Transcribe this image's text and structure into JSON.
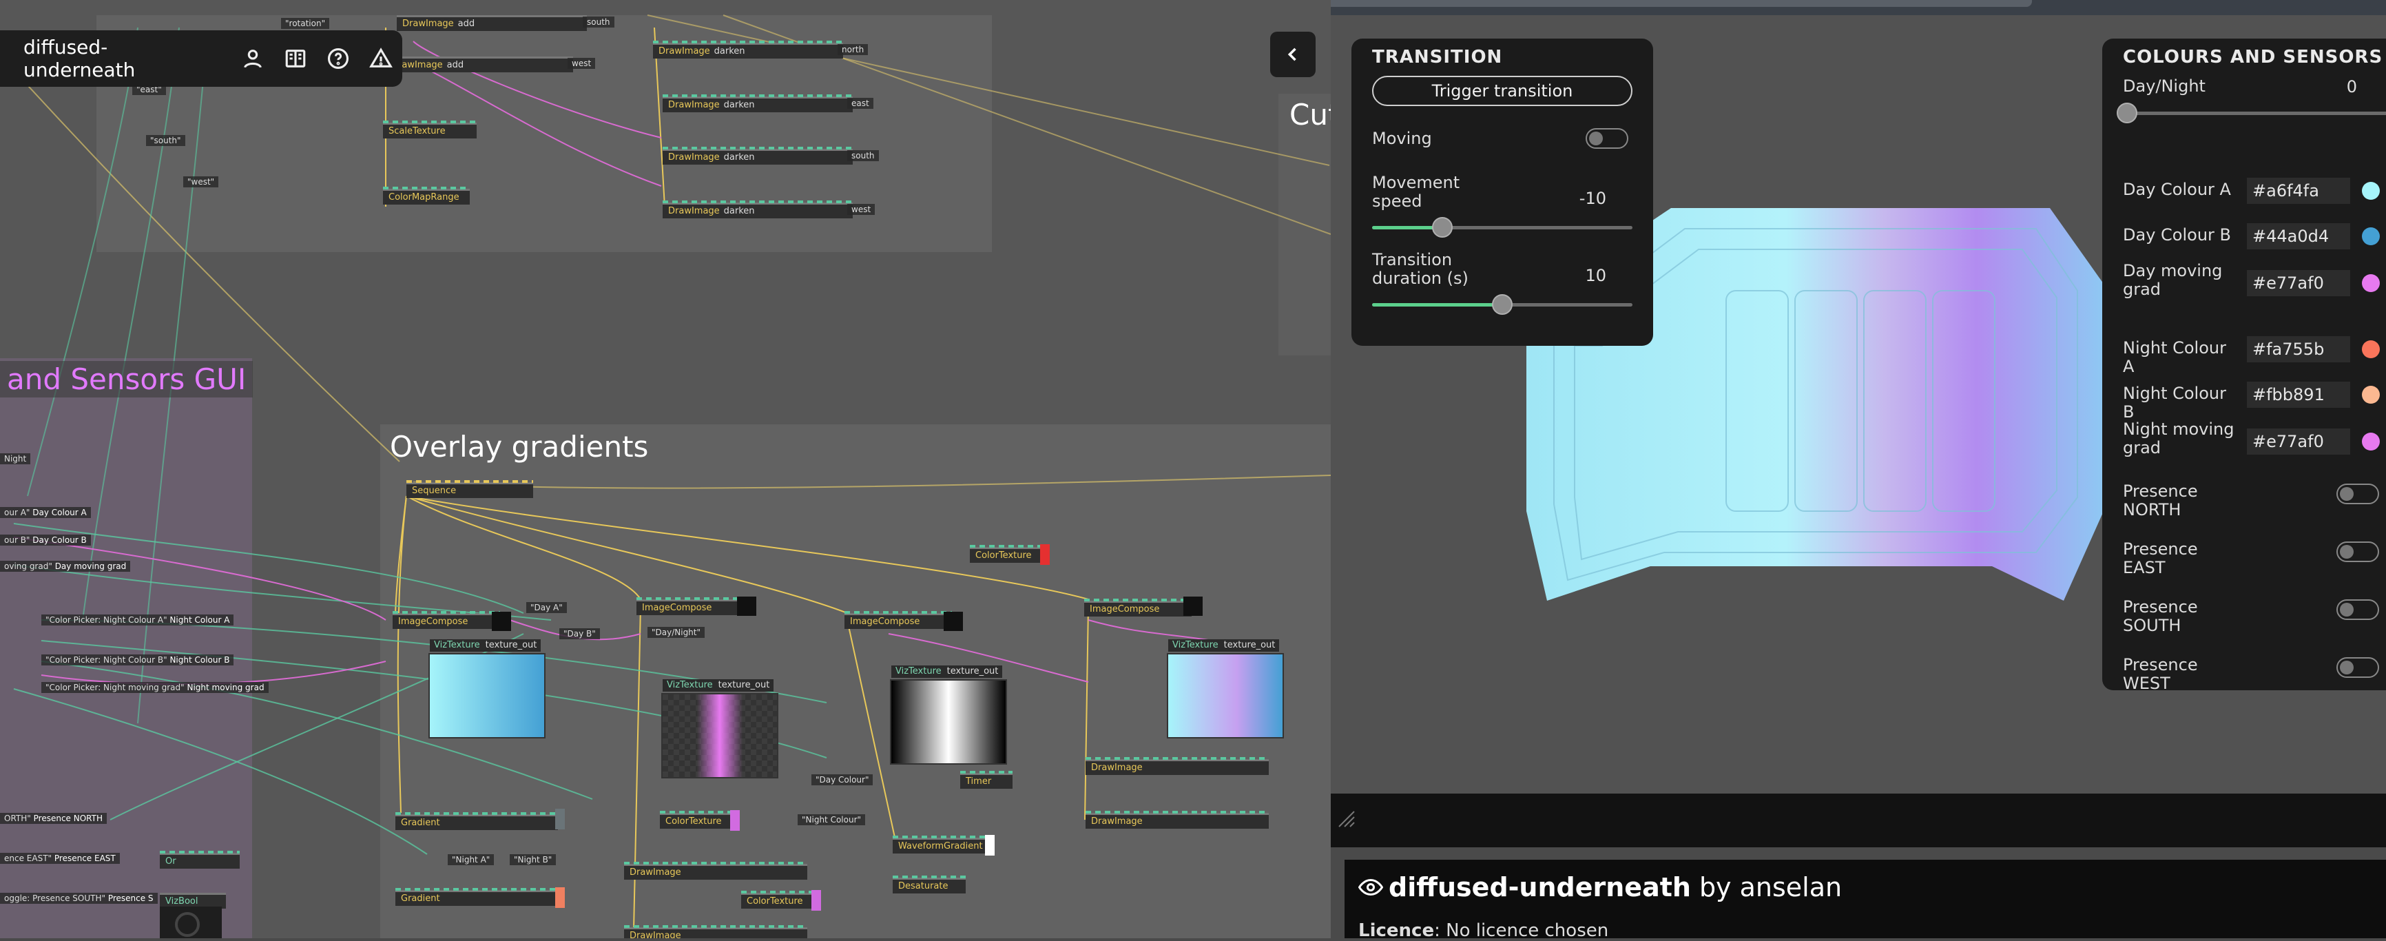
{
  "toolbar": {
    "project_name": "diffused-underneath",
    "icons": [
      "user-icon",
      "book-icon",
      "help-icon",
      "warning-icon"
    ]
  },
  "editor": {
    "titles": {
      "colour_gui": "and Sensors GUI",
      "overlay": "Overlay gradients",
      "cut": "Cut"
    },
    "ops_top": [
      {
        "name": "DrawImage",
        "sub": "add",
        "side": "south"
      },
      {
        "name": "DrawImage",
        "sub": "add",
        "side": "west"
      },
      {
        "name": "ScaleTexture",
        "sub": ""
      },
      {
        "name": "ColorMapRange",
        "sub": ""
      },
      {
        "name": "DrawImage",
        "sub": "darken",
        "side": "north"
      },
      {
        "name": "DrawImage",
        "sub": "darken",
        "side": "east"
      },
      {
        "name": "DrawImage",
        "sub": "darken",
        "side": "south"
      },
      {
        "name": "DrawImage",
        "sub": "darken",
        "side": "west"
      }
    ],
    "strings_top": [
      "\"rotation\"",
      "\"east\"",
      "\"south\"",
      "\"west\""
    ],
    "gui_rows": [
      {
        "tag": "Night",
        "label": ""
      },
      {
        "tag": "our A\"",
        "label": "Day Colour A"
      },
      {
        "tag": "our B\"",
        "label": "Day Colour B"
      },
      {
        "tag": "oving grad\"",
        "label": "Day moving grad"
      },
      {
        "tag": "\"Color Picker: Night Colour A\"",
        "label": "Night Colour A"
      },
      {
        "tag": "\"Color Picker: Night Colour B\"",
        "label": "Night Colour B"
      },
      {
        "tag": "\"Color Picker: Night moving grad\"",
        "label": "Night moving grad"
      },
      {
        "tag": "ORTH\"",
        "label": "Presence NORTH"
      },
      {
        "tag": "ence EAST\"",
        "label": "Presence EAST"
      },
      {
        "tag": "oggle: Presence SOUTH\"",
        "label": "Presence S"
      }
    ],
    "overlay_ops": {
      "sequence": "Sequence",
      "imagecompose": "ImageCompose",
      "viztexture": "VizTexture",
      "texture_out": "texture_out",
      "gradient": "Gradient",
      "colortexture": "ColorTexture",
      "drawimage": "DrawImage",
      "waveform": "WaveformGradient",
      "desaturate": "Desaturate",
      "timer": "Timer",
      "vizbool": "VizBool",
      "or": "Or",
      "day_a": "\"Day A\"",
      "day_b": "\"Day B\"",
      "night_a": "\"Night A\"",
      "night_b": "\"Night B\"",
      "daynight": "\"Day/Night\"",
      "day_colour": "\"Day Colour\"",
      "night_colour": "\"Night Colour\""
    }
  },
  "transition_panel": {
    "title": "TRANSITION",
    "trigger_label": "Trigger transition",
    "moving_label": "Moving",
    "moving_on": false,
    "speed_label": "Movement speed",
    "speed_value": "-10",
    "speed_fraction": 0.27,
    "duration_label": "Transition duration (s)",
    "duration_value": "10",
    "duration_fraction": 0.5
  },
  "colours_panel": {
    "title": "COLOURS AND SENSORS",
    "daynight_label": "Day/Night",
    "daynight_value": "0",
    "daynight_fraction": 0.0,
    "colours": [
      {
        "label": "Day Colour A",
        "hex": "#a6f4fa",
        "color": "#a6f4fa"
      },
      {
        "label": "Day Colour B",
        "hex": "#44a0d4",
        "color": "#44a0d4"
      },
      {
        "label": "Day moving grad",
        "hex": "#e77af0",
        "color": "#e77af0"
      },
      {
        "label": "Night Colour A",
        "hex": "#fa755b",
        "color": "#fa755b"
      },
      {
        "label": "Night Colour B",
        "hex": "#fbb891",
        "color": "#fbb891"
      },
      {
        "label": "Night moving grad",
        "hex": "#e77af0",
        "color": "#e77af0"
      }
    ],
    "presence": [
      {
        "label": "Presence NORTH",
        "on": false
      },
      {
        "label": "Presence EAST",
        "on": false
      },
      {
        "label": "Presence SOUTH",
        "on": false
      },
      {
        "label": "Presence WEST",
        "on": false
      }
    ]
  },
  "info": {
    "project_name": "diffused-underneath",
    "by": "by anselan",
    "licence_label": "Licence",
    "licence_value": ": No licence chosen"
  },
  "accent_colors": {
    "wire_yellow": "#e8c85a",
    "wire_green": "#5ac8a0",
    "wire_pink": "#d86bd0",
    "slider_fill": "#5cd08c"
  }
}
